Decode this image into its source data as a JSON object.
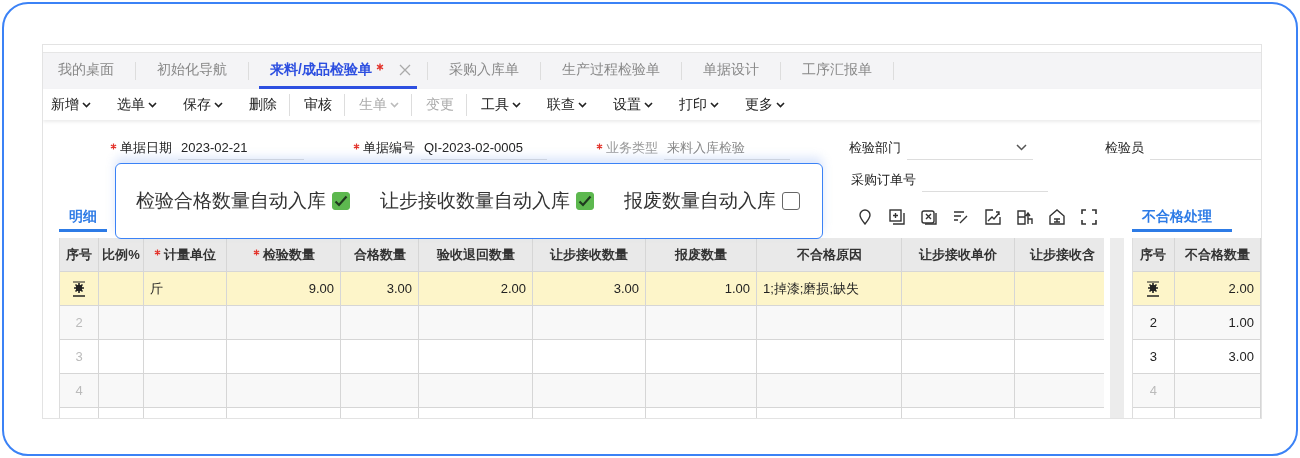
{
  "tabs": [
    {
      "label": "我的桌面",
      "selected": false,
      "modified": false
    },
    {
      "label": "初始化导航",
      "selected": false,
      "modified": false
    },
    {
      "label": "来料/成品检验单",
      "selected": true,
      "modified": true
    },
    {
      "label": "采购入库单",
      "selected": false,
      "modified": false
    },
    {
      "label": "生产过程检验单",
      "selected": false,
      "modified": false
    },
    {
      "label": "单据设计",
      "selected": false,
      "modified": false
    },
    {
      "label": "工序汇报单",
      "selected": false,
      "modified": false
    }
  ],
  "toolbar": [
    {
      "label": "新增",
      "dropdown": true,
      "disabled": false,
      "divider_after": false
    },
    {
      "label": "选单",
      "dropdown": true,
      "disabled": false,
      "divider_after": false
    },
    {
      "label": "保存",
      "dropdown": true,
      "disabled": false,
      "divider_after": false
    },
    {
      "label": "删除",
      "dropdown": false,
      "disabled": false,
      "divider_after": true
    },
    {
      "label": "审核",
      "dropdown": false,
      "disabled": false,
      "divider_after": true
    },
    {
      "label": "生单",
      "dropdown": true,
      "disabled": true,
      "divider_after": true
    },
    {
      "label": "变更",
      "dropdown": false,
      "disabled": true,
      "divider_after": true
    },
    {
      "label": "工具",
      "dropdown": true,
      "disabled": false,
      "divider_after": false
    },
    {
      "label": "联查",
      "dropdown": true,
      "disabled": false,
      "divider_after": false
    },
    {
      "label": "设置",
      "dropdown": true,
      "disabled": false,
      "divider_after": false
    },
    {
      "label": "打印",
      "dropdown": true,
      "disabled": false,
      "divider_after": false
    },
    {
      "label": "更多",
      "dropdown": true,
      "disabled": false,
      "divider_after": false
    }
  ],
  "form_rows": [
    [
      {
        "label": "单据日期",
        "required": true,
        "disabled": false,
        "kind": "text",
        "value": "2023-02-21"
      },
      {
        "label": "单据编号",
        "required": true,
        "disabled": false,
        "kind": "text",
        "value": "QI-2023-02-0005"
      },
      {
        "label": "业务类型",
        "required": true,
        "disabled": true,
        "kind": "text",
        "value": "来料入库检验"
      },
      {
        "label": "检验部门",
        "required": false,
        "disabled": false,
        "kind": "select"
      },
      {
        "label": "检验员",
        "required": false,
        "disabled": false,
        "kind": "text"
      }
    ],
    [
      {
        "kind": "blank"
      },
      {
        "kind": "blank"
      },
      {
        "kind": "blank"
      },
      {
        "label": "采购订单号",
        "required": false,
        "disabled": false,
        "kind": "text"
      }
    ]
  ],
  "callout": {
    "checkboxes": [
      {
        "label": "检验合格数量自动入库",
        "checked": true
      },
      {
        "label": "让步接收数量自动入库",
        "checked": true
      },
      {
        "label": "报废数量自动入库",
        "checked": false
      }
    ]
  },
  "detail": {
    "tabs": [
      {
        "label": "明细",
        "selected": true
      }
    ],
    "table": {
      "columns": [
        {
          "label": "序号",
          "required": false
        },
        {
          "label": "比例%",
          "required": false
        },
        {
          "label": "计量单位",
          "required": true
        },
        {
          "label": "检验数量",
          "required": true
        },
        {
          "label": "合格数量",
          "required": false
        },
        {
          "label": "验收退回数量",
          "required": false
        },
        {
          "label": "让步接收数量",
          "required": false
        },
        {
          "label": "报废数量",
          "required": false
        },
        {
          "label": "不合格原因",
          "required": false
        },
        {
          "label": "让步接收单价",
          "required": false
        },
        {
          "label": "让步接收含",
          "required": false
        }
      ],
      "rows": [
        {
          "selected": true,
          "cells": [
            "",
            "",
            "斤",
            "9.00",
            "3.00",
            "2.00",
            "3.00",
            "1.00",
            "1;掉漆;磨损;缺失",
            "",
            ""
          ]
        },
        {
          "selected": false,
          "cells": [
            "2",
            "",
            "",
            "",
            "",
            "",
            "",
            "",
            "",
            "",
            ""
          ]
        },
        {
          "selected": false,
          "cells": [
            "3",
            "",
            "",
            "",
            "",
            "",
            "",
            "",
            "",
            "",
            ""
          ]
        },
        {
          "selected": false,
          "cells": [
            "4",
            "",
            "",
            "",
            "",
            "",
            "",
            "",
            "",
            "",
            ""
          ]
        }
      ]
    }
  },
  "defects": {
    "tabs": [
      {
        "label": "不合格处理",
        "selected": true
      }
    ],
    "table": {
      "columns": [
        {
          "label": "序号"
        },
        {
          "label": "不合格数量"
        }
      ],
      "rows": [
        {
          "selected": true,
          "cells": [
            "",
            "2.00"
          ]
        },
        {
          "selected": false,
          "cells": [
            "2",
            "1.00"
          ]
        },
        {
          "selected": false,
          "cells": [
            "3",
            "3.00"
          ]
        },
        {
          "selected": false,
          "cells": [
            "4",
            ""
          ]
        }
      ]
    }
  }
}
